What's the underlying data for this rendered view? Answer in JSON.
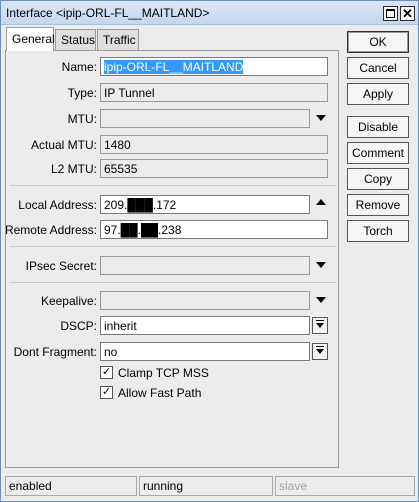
{
  "window": {
    "title": "Interface <ipip-ORL-FL__MAITLAND>"
  },
  "tabs": [
    {
      "label": "General"
    },
    {
      "label": "Status"
    },
    {
      "label": "Traffic"
    }
  ],
  "form": {
    "name": {
      "label": "Name:",
      "value": "ipip-ORL-FL__MAITLAND"
    },
    "type": {
      "label": "Type:",
      "value": "IP Tunnel"
    },
    "mtu": {
      "label": "MTU:",
      "value": ""
    },
    "actual_mtu": {
      "label": "Actual MTU:",
      "value": "1480"
    },
    "l2_mtu": {
      "label": "L2 MTU:",
      "value": "65535"
    },
    "local_address": {
      "label": "Local Address:",
      "value": "209.███.172"
    },
    "remote_address": {
      "label": "Remote Address:",
      "value": "97.██.██.238"
    },
    "ipsec_secret": {
      "label": "IPsec Secret:",
      "value": ""
    },
    "keepalive": {
      "label": "Keepalive:",
      "value": ""
    },
    "dscp": {
      "label": "DSCP:",
      "value": "inherit"
    },
    "dont_fragment": {
      "label": "Dont Fragment:",
      "value": "no"
    },
    "clamp_tcp_mss": {
      "label": "Clamp TCP MSS",
      "checked": true
    },
    "allow_fast_path": {
      "label": "Allow Fast Path",
      "checked": true
    }
  },
  "buttons": {
    "ok": "OK",
    "cancel": "Cancel",
    "apply": "Apply",
    "disable": "Disable",
    "comment": "Comment",
    "copy": "Copy",
    "remove": "Remove",
    "torch": "Torch"
  },
  "status_bar": {
    "state": "enabled",
    "running": "running",
    "slave": "slave"
  }
}
